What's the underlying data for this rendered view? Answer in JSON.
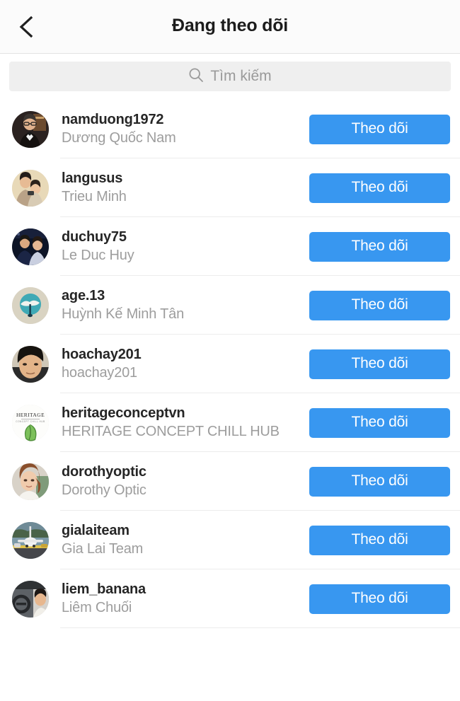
{
  "header": {
    "title": "Đang theo dõi",
    "back_icon": "chevron-left-icon"
  },
  "search": {
    "placeholder": "Tìm kiếm",
    "value": "",
    "icon": "search-icon",
    "background": "#efefef"
  },
  "theme": {
    "accent": "#3897f0",
    "username_color": "#262626",
    "fullname_color": "#9d9d9d",
    "divider": "#ececec",
    "header_bg": "#fbfbfb"
  },
  "list": {
    "follow_label": "Theo dõi",
    "users": [
      {
        "username": "namduong1972",
        "fullname": "Dương Quốc Nam",
        "action": "Theo dõi",
        "avatar": "man-in-tuxedo-photo"
      },
      {
        "username": "langusus",
        "fullname": "Trieu Minh",
        "action": "Theo dõi",
        "avatar": "couple-portrait-photo"
      },
      {
        "username": "duchuy75",
        "fullname": "Le Duc Huy",
        "action": "Theo dõi",
        "avatar": "couple-night-event-photo"
      },
      {
        "username": "age.13",
        "fullname": "Huỳnh Kế Minh Tân",
        "action": "Theo dõi",
        "avatar": "teal-circle-figure-logo"
      },
      {
        "username": "hoachay201",
        "fullname": "hoachay201",
        "action": "Theo dõi",
        "avatar": "man-face-closeup-photo"
      },
      {
        "username": "heritageconceptvn",
        "fullname": "HERITAGE CONCEPT CHILL HUB",
        "action": "Theo dõi",
        "avatar": "heritage-leaf-logo"
      },
      {
        "username": "dorothyoptic",
        "fullname": "Dorothy Optic",
        "action": "Theo dõi",
        "avatar": "woman-auburn-hair-photo"
      },
      {
        "username": "gialaiteam",
        "fullname": "Gia Lai Team",
        "action": "Theo dõi",
        "avatar": "airplane-photo"
      },
      {
        "username": "liem_banana",
        "fullname": "Liêm Chuối",
        "action": "Theo dõi",
        "avatar": "man-driving-car-photo"
      }
    ]
  }
}
